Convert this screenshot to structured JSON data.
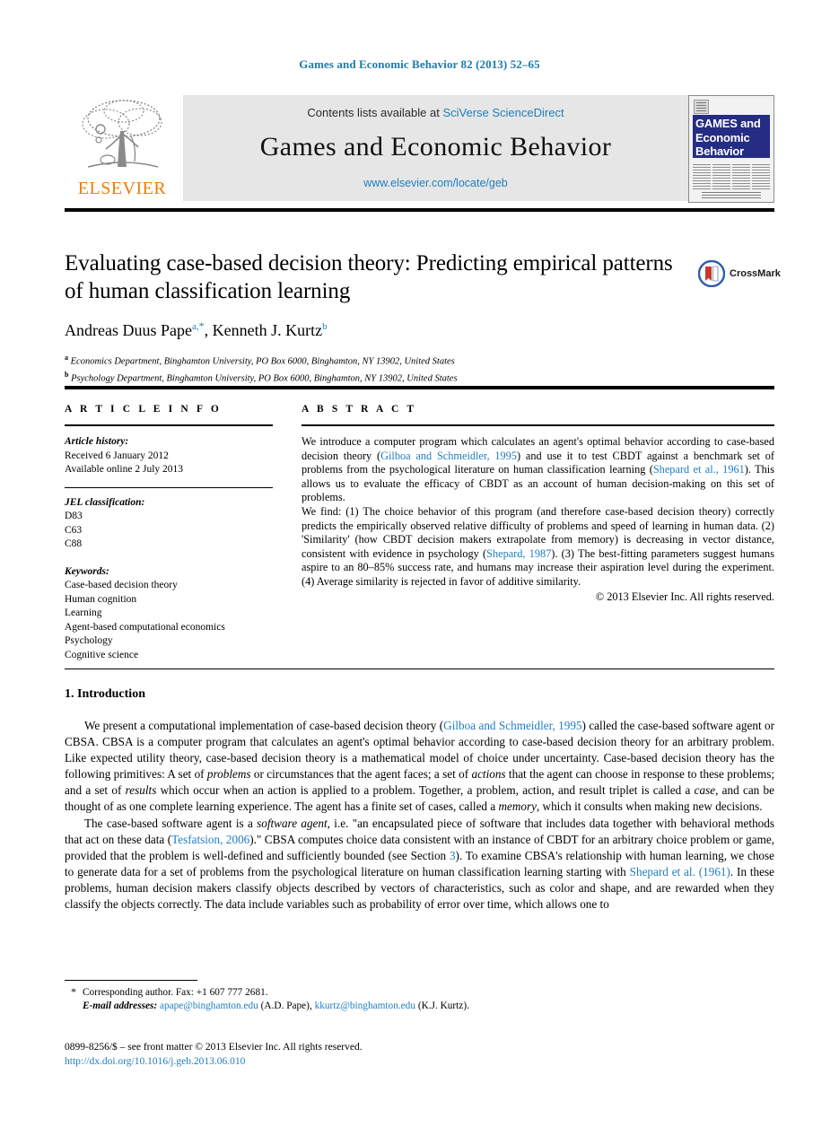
{
  "running_head": "Games and Economic Behavior 82 (2013) 52–65",
  "masthead": {
    "publisher_name": "ELSEVIER",
    "contents_prefix": "Contents lists available at",
    "contents_link": "SciVerse ScienceDirect",
    "journal_title": "Games and Economic Behavior",
    "journal_url": "www.elsevier.com/locate/geb",
    "cover": {
      "line1": "GAMES and",
      "line2": "Economic",
      "line3": "Behavior"
    }
  },
  "article": {
    "title": "Evaluating case-based decision theory: Predicting empirical patterns of human classification learning",
    "authors_part1": "Andreas Duus Pape",
    "author1_marks": "a,",
    "author1_star": "*",
    "authors_part2": ", Kenneth J. Kurtz",
    "author2_mark": "b",
    "affiliation_a_mark": "a",
    "affiliation_a": "Economics Department, Binghamton University, PO Box 6000, Binghamton, NY 13902, United States",
    "affiliation_b_mark": "b",
    "affiliation_b": "Psychology Department, Binghamton University, PO Box 6000, Binghamton, NY 13902, United States",
    "crossmark_label": "CrossMark"
  },
  "info": {
    "heading": "A R T I C L E   I N F O",
    "history_label": "Article history:",
    "history_lines": [
      "Received 6 January 2012",
      "Available online 2 July 2013"
    ],
    "jel_label": "JEL classification:",
    "jel_codes": [
      "D83",
      "C63",
      "C88"
    ],
    "keywords_label": "Keywords:",
    "keywords": [
      "Case-based decision theory",
      "Human cognition",
      "Learning",
      "Agent-based computational economics",
      "Psychology",
      "Cognitive science"
    ]
  },
  "abstract": {
    "heading": "A B S T R A C T",
    "p1_a": "We introduce a computer program which calculates an agent's optimal behavior according to case-based decision theory (",
    "p1_cite1": "Gilboa and Schmeidler, 1995",
    "p1_b": ") and use it to test CBDT against a benchmark set of problems from the psychological literature on human classification learning (",
    "p1_cite2": "Shepard et al., 1961",
    "p1_c": "). This allows us to evaluate the efficacy of CBDT as an account of human decision-making on this set of problems.",
    "p2_a": "We find: (1) The choice behavior of this program (and therefore case-based decision theory) correctly predicts the empirically observed relative difficulty of problems and speed of learning in human data. (2) 'Similarity' (how CBDT decision makers extrapolate from memory) is decreasing in vector distance, consistent with evidence in psychology (",
    "p2_cite1": "Shepard, 1987",
    "p2_b": "). (3) The best-fitting parameters suggest humans aspire to an 80–85% success rate, and humans may increase their aspiration level during the experiment. (4) Average similarity is rejected in favor of additive similarity.",
    "copyright": "© 2013 Elsevier Inc. All rights reserved."
  },
  "body": {
    "section_title": "1. Introduction",
    "p1_a": "We present a computational implementation of case-based decision theory (",
    "p1_cite1": "Gilboa and Schmeidler, 1995",
    "p1_b": ") called the case-based software agent or CBSA. CBSA is a computer program that calculates an agent's optimal behavior according to case-based decision theory for an arbitrary problem. Like expected utility theory, case-based decision theory is a mathematical model of choice under uncertainty. Case-based decision theory has the following primitives: A set of ",
    "p1_i1": "problems",
    "p1_c": " or circumstances that the agent faces; a set of ",
    "p1_i2": "actions",
    "p1_d": " that the agent can choose in response to these problems; and a set of ",
    "p1_i3": "results",
    "p1_e": " which occur when an action is applied to a problem. Together, a problem, action, and result triplet is called a ",
    "p1_i4": "case",
    "p1_f": ", and can be thought of as one complete learning experience. The agent has a finite set of cases, called a ",
    "p1_i5": "memory",
    "p1_g": ", which it consults when making new decisions.",
    "p2_a": "The case-based software agent is a ",
    "p2_i1": "software agent",
    "p2_b": ", i.e. \"an encapsulated piece of software that includes data together with behavioral methods that act on these data (",
    "p2_cite1": "Tesfatsion, 2006",
    "p2_c": ").\" CBSA computes choice data consistent with an instance of CBDT for an arbitrary choice problem or game, provided that the problem is well-defined and sufficiently bounded (see Section ",
    "p2_cite2": "3",
    "p2_d": "). To examine CBSA's relationship with human learning, we chose to generate data for a set of problems from the psychological literature on human classification learning starting with ",
    "p2_cite3": "Shepard et al. (1961)",
    "p2_e": ". In these problems, human decision makers classify objects described by vectors of characteristics, such as color and shape, and are rewarded when they classify the objects correctly. The data include variables such as probability of error over time, which allows one to"
  },
  "footer": {
    "corresponding_star": "*",
    "corresponding_text": "Corresponding author. Fax: +1 607 777 2681.",
    "email_label": "E-mail addresses:",
    "email1": "apape@binghamton.edu",
    "email1_owner": "(A.D. Pape),",
    "email2": "kkurtz@binghamton.edu",
    "email2_owner": "(K.J. Kurtz).",
    "issn_line": "0899-8256/$ – see front matter  © 2013 Elsevier Inc. All rights reserved.",
    "doi": "http://dx.doi.org/10.1016/j.geb.2013.06.010"
  },
  "colors": {
    "link_blue": "#1f7ec0",
    "elsevier_orange": "#ef7d00",
    "cover_navy": "#252c84"
  }
}
